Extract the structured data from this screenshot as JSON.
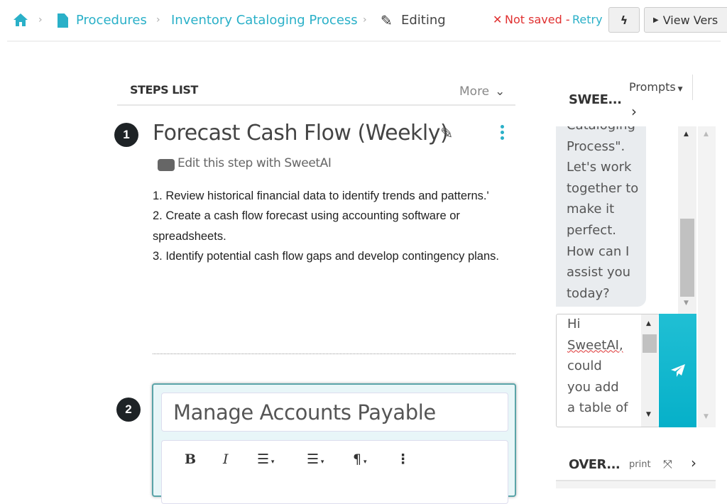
{
  "breadcrumb": {
    "home_icon": "home-icon",
    "items": [
      "Procedures",
      "Inventory Cataloging Process"
    ],
    "current": "Editing"
  },
  "save_status": {
    "text": "Not saved -",
    "retry": "Retry",
    "color": "#e03030"
  },
  "toolbar": {
    "lightning_icon": "bolt-icon",
    "view_versions": "View Vers"
  },
  "steps": {
    "header": "STEPS LIST",
    "more": "More",
    "step1": {
      "number": "1",
      "title": "Forecast Cash Flow (Weekly)",
      "ai_edit": "Edit this step with SweetAI",
      "lines": [
        "1. Review historical financial data to identify trends and patterns.'",
        "2. Create a cash flow forecast using accounting software or spreadsheets.",
        "3. Identify potential cash flow gaps and develop contingency plans."
      ]
    },
    "step2": {
      "number": "2",
      "title_value": "Manage Accounts Payable",
      "editor_tools": [
        "B",
        "I"
      ]
    }
  },
  "sweetai": {
    "title": "SWEE...",
    "prompts": "Prompts",
    "message_lines": [
      "Cataloging",
      "Process\".",
      "Let's work",
      "together to",
      "make it",
      "perfect.",
      "How can I",
      "assist you",
      "today?"
    ],
    "input_value_lines": [
      "Hi",
      "SweetAI,",
      "could",
      "you add",
      "a table of",
      "..."
    ],
    "accent": "#17b5cc"
  },
  "overview": {
    "title": "OVER...",
    "print": "print"
  }
}
